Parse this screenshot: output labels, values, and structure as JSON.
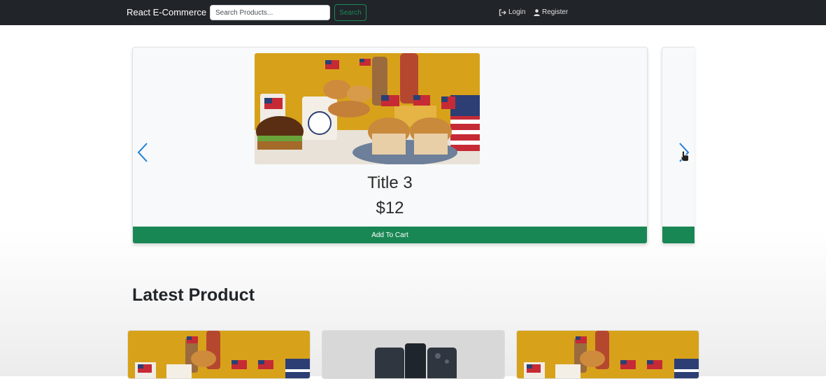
{
  "navbar": {
    "brand": "React E-Commerce",
    "search_placeholder": "Search Products...",
    "search_button": "Search",
    "login": "Login",
    "register": "Register"
  },
  "carousel": {
    "active_item": {
      "title": "Title 3",
      "price": "$12",
      "add_to_cart": "Add To Cart",
      "image": "food-with-american-flags"
    },
    "prev_icon": "chevron-left-icon",
    "next_icon": "chevron-right-icon"
  },
  "latest": {
    "title": "Latest Product",
    "products": [
      {
        "image": "food-with-american-flags"
      },
      {
        "image": "black-smartphones"
      },
      {
        "image": "food-with-american-flags"
      }
    ]
  },
  "colors": {
    "navbar_bg": "#212529",
    "accent_green": "#198754",
    "arrow_blue": "#1e7fd6"
  }
}
